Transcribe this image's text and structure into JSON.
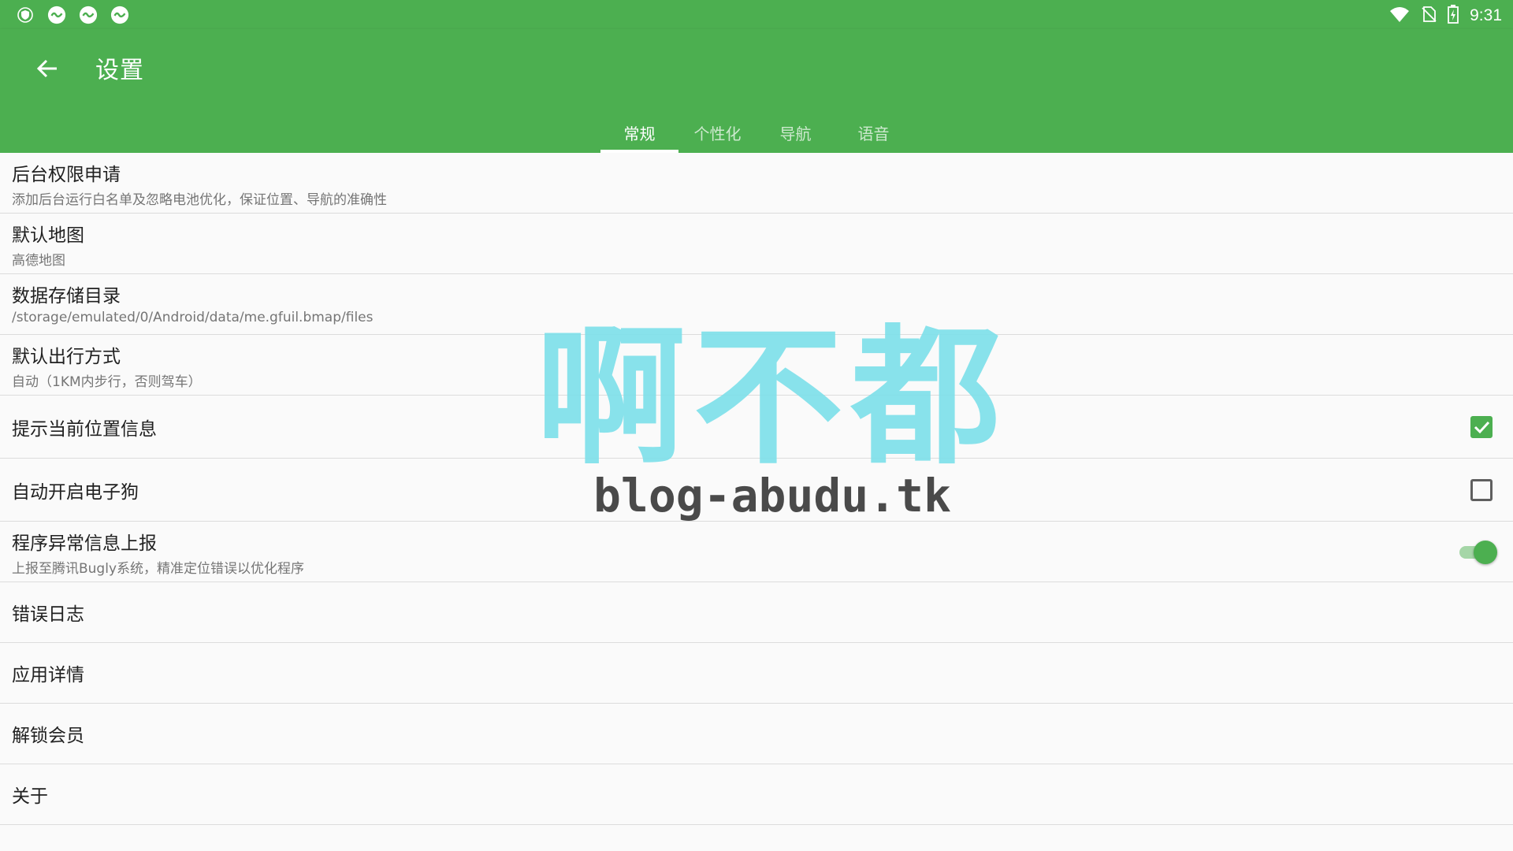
{
  "status_bar": {
    "time": "9:31",
    "left_icons": [
      "vpn-shield-icon",
      "app-notification-icon",
      "app-notification-icon",
      "app-notification-icon"
    ],
    "right_icons": [
      "wifi-icon",
      "no-sim-icon",
      "battery-charging-icon"
    ]
  },
  "app_bar": {
    "title": "设置",
    "back_icon": "arrow-back-icon"
  },
  "tabs": [
    {
      "label": "常规",
      "active": true
    },
    {
      "label": "个性化",
      "active": false
    },
    {
      "label": "导航",
      "active": false
    },
    {
      "label": "语音",
      "active": false
    }
  ],
  "settings": [
    {
      "title": "后台权限申请",
      "summary": "添加后台运行白名单及忽略电池优化，保证位置、导航的准确性"
    },
    {
      "title": "默认地图",
      "summary": "高德地图"
    },
    {
      "title": "数据存储目录",
      "summary": "/storage/emulated/0/Android/data/me.gfuil.bmap/files"
    },
    {
      "title": "默认出行方式",
      "summary": "自动（1KM内步行，否则驾车）"
    },
    {
      "title": "提示当前位置信息",
      "checked": true
    },
    {
      "title": "自动开启电子狗",
      "checked": false
    },
    {
      "title": "程序异常信息上报",
      "summary": "上报至腾讯Bugly系统，精准定位错误以优化程序",
      "enabled": true
    },
    {
      "title": "错误日志"
    },
    {
      "title": "应用详情"
    },
    {
      "title": "解锁会员"
    },
    {
      "title": "关于"
    }
  ],
  "watermark": {
    "text": "啊不都",
    "url": "blog-abudu.tk"
  },
  "colors": {
    "primary": "#4caf50",
    "accent": "#4caf50",
    "watermark": "#7fe0ea"
  }
}
